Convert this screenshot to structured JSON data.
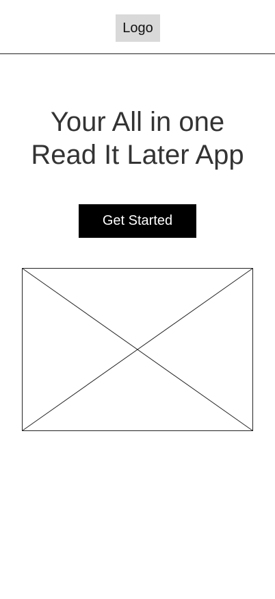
{
  "header": {
    "logo_label": "Logo"
  },
  "hero": {
    "title_line1": "Your All in one",
    "title_line2": "Read It Later App",
    "cta_label": "Get Started"
  },
  "media": {
    "icon": "image-placeholder-icon"
  }
}
